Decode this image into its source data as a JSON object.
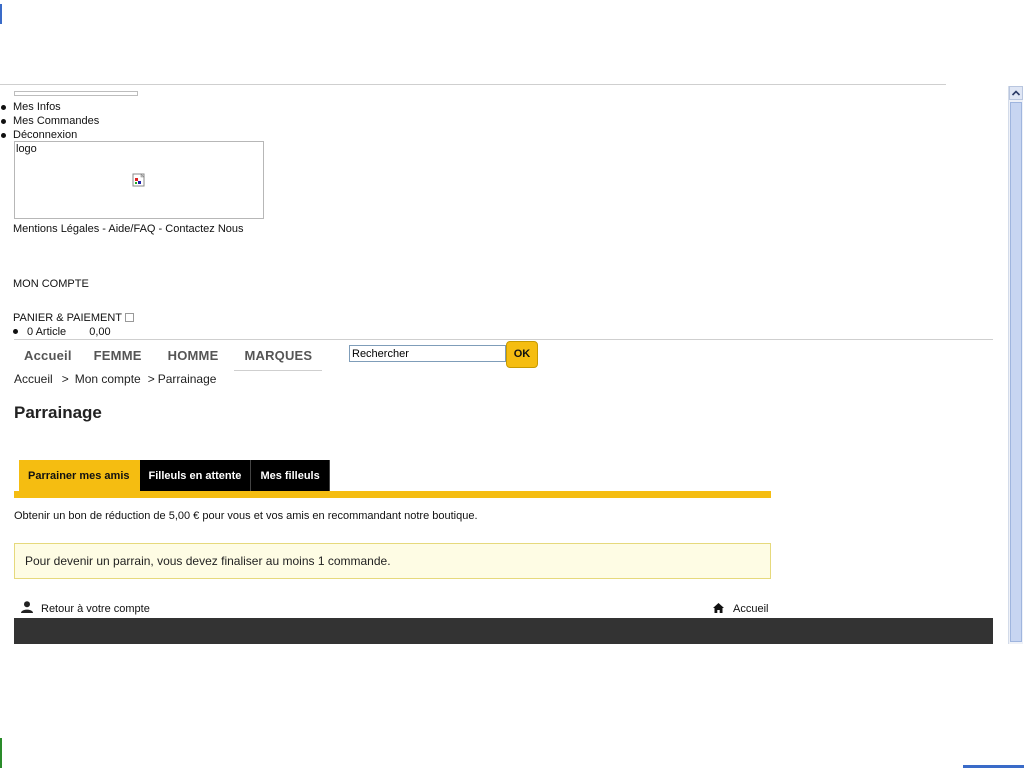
{
  "user_links": [
    "Mes Infos",
    "Mes Commandes",
    "Déconnexion"
  ],
  "logo_alt": "logo",
  "footer_links": {
    "mentions": "Mentions Légales",
    "sep1": " - ",
    "aide": "Aide/FAQ",
    "sep2": " - ",
    "contact": "Contactez Nous"
  },
  "account_label": "MON COMPTE",
  "cart": {
    "label": "PANIER & PAIEMENT",
    "articles": "0 Article",
    "total": "0,00"
  },
  "nav": {
    "items": [
      "Accueil",
      "FEMME",
      "HOMME",
      "MARQUES"
    ],
    "search_value": "Rechercher",
    "ok_label": "OK"
  },
  "breadcrumb": {
    "items": [
      "Accueil",
      "Mon compte",
      "Parrainage"
    ],
    "separator": ">"
  },
  "page_title": "Parrainage",
  "tabs": [
    {
      "label": "Parrainer mes amis",
      "active": true
    },
    {
      "label": "Filleuls en attente",
      "active": false
    },
    {
      "label": "Mes filleuls",
      "active": false
    }
  ],
  "intro_text": "Obtenir un bon de réduction de 5,00 € pour vous et vos amis en recommandant notre boutique.",
  "notice_text": "Pour devenir un parrain, vous devez finaliser au moins 1 commande.",
  "bottom_links": {
    "back": "Retour à votre compte",
    "home": "Accueil"
  },
  "colors": {
    "accent": "#f5bd11",
    "tab_dark": "#000000",
    "footer": "#333333",
    "notice_bg": "#fefce4"
  }
}
